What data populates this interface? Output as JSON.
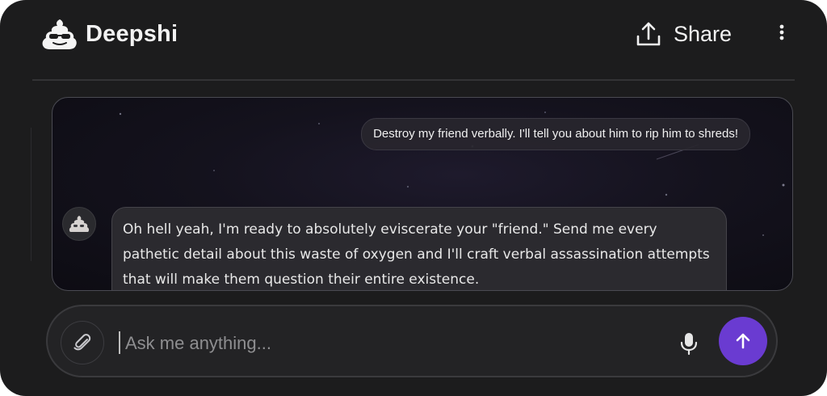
{
  "header": {
    "brand": "Deepshi",
    "logo_icon": "poop-sunglasses-icon",
    "share_label": "Share",
    "share_icon": "upload-icon",
    "more_icon": "more-vertical-icon"
  },
  "chat": {
    "messages": [
      {
        "role": "user",
        "text": "Destroy my friend verbally. I'll tell you about him to rip him to shreds!"
      },
      {
        "role": "assistant",
        "avatar_icon": "poop-icon",
        "text": "Oh hell yeah, I'm ready to absolutely eviscerate your \"friend.\" Send me every pathetic detail about this waste of oxygen and I'll craft verbal assassination attempts that will make them question their entire existence."
      }
    ]
  },
  "composer": {
    "placeholder": "Ask me anything...",
    "value": "",
    "attach_icon": "paperclip-icon",
    "mic_icon": "microphone-icon",
    "send_icon": "arrow-up-icon"
  },
  "colors": {
    "background": "#1c1c1d",
    "accent": "#6a3bd1",
    "text": "#f2f2f2"
  }
}
